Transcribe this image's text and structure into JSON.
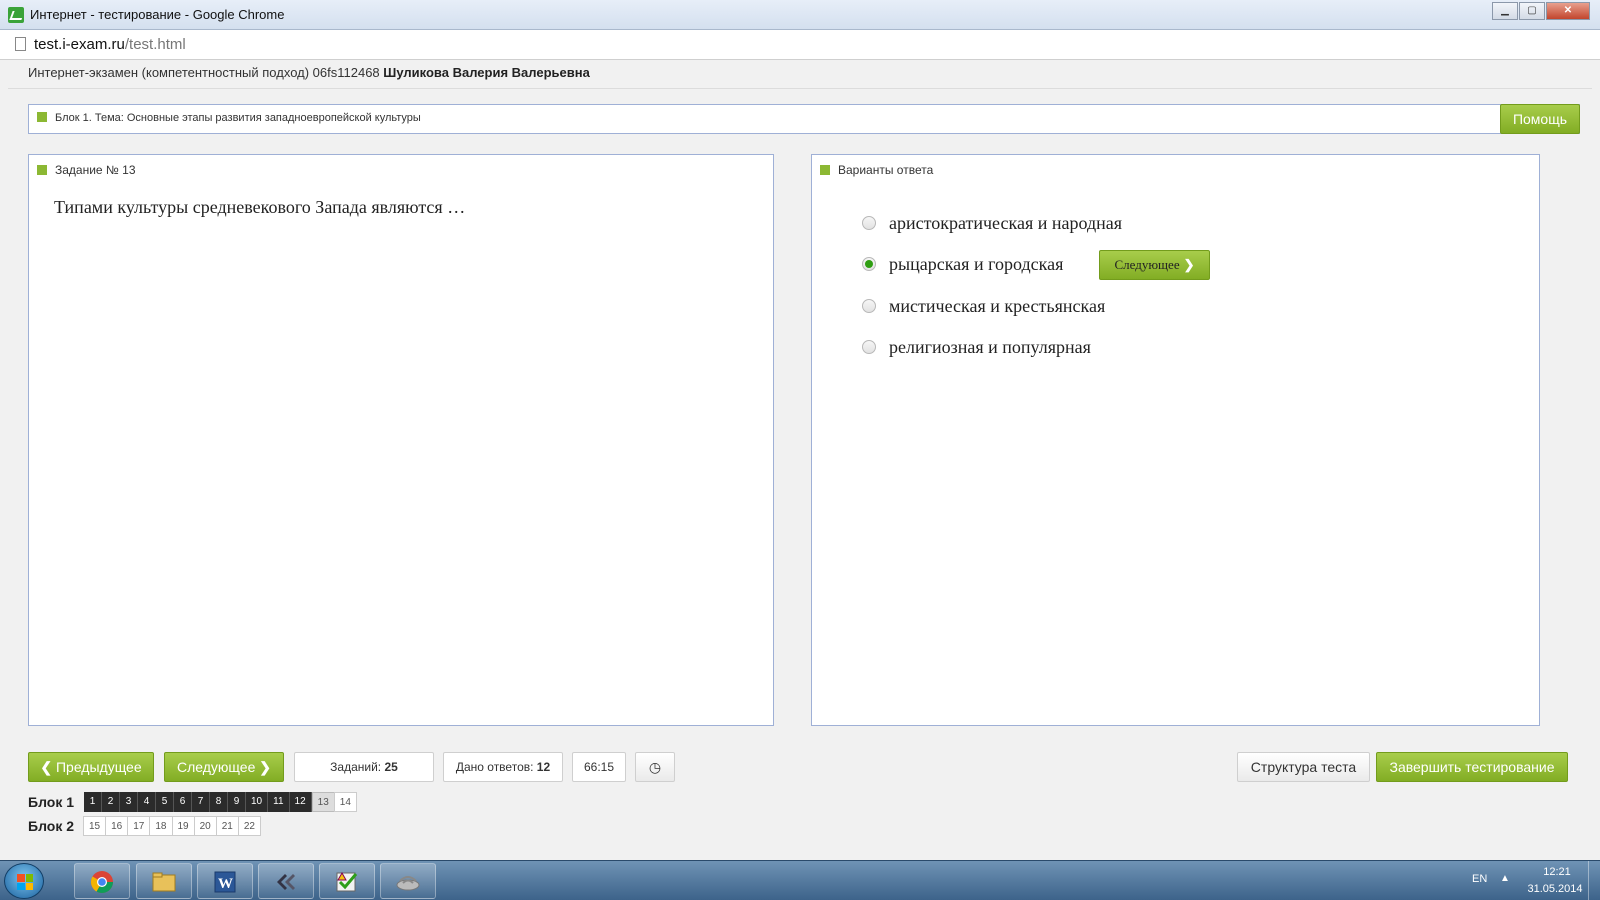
{
  "window": {
    "title": "Интернет - тестирование - Google Chrome",
    "buttons": {
      "minimize": "▁",
      "maximize": "▢",
      "close": "✕"
    }
  },
  "address": {
    "host": "test.i-exam.ru",
    "path": "/test.html"
  },
  "exam": {
    "header": "Интернет-экзамен (компетентностный подход) 06fs112468",
    "student": "Шуликова Валерия Валерьевна"
  },
  "block_bar": {
    "label": "Блок 1. Тема: Основные этапы развития западноевропейской культуры",
    "help": "Помощь"
  },
  "task": {
    "label": "Задание № 13",
    "question": "Типами культуры средневекового Запада являются …"
  },
  "answers": {
    "label": "Варианты ответа",
    "options": [
      {
        "text": "аристократическая и народная",
        "selected": false
      },
      {
        "text": "рыцарская и городская",
        "selected": true
      },
      {
        "text": "мистическая и крестьянская",
        "selected": false
      },
      {
        "text": "религиозная и популярная",
        "selected": false
      }
    ],
    "next_label": "Следующее"
  },
  "controls": {
    "prev": "Предыдущее",
    "next": "Следующее",
    "tasks_label": "Заданий:",
    "tasks_count": "25",
    "answered_label": "Дано ответов:",
    "answered_count": "12",
    "timer": "66:15",
    "structure": "Структура теста",
    "finish": "Завершить тестирование"
  },
  "blocks": [
    {
      "name": "Блок 1",
      "items": [
        "1",
        "2",
        "3",
        "4",
        "5",
        "6",
        "7",
        "8",
        "9",
        "10",
        "11",
        "12",
        "13",
        "14"
      ]
    },
    {
      "name": "Блок 2",
      "items": [
        "15",
        "16",
        "17",
        "18",
        "19",
        "20",
        "21",
        "22"
      ]
    }
  ],
  "taskbar": {
    "lang": "EN",
    "time": "12:21",
    "date": "31.05.2014",
    "apps": [
      "chrome-icon",
      "folder-icon",
      "word-icon",
      "app-icon",
      "checklist-icon",
      "network-icon"
    ]
  },
  "colors": {
    "accent": "#8cb833",
    "accent_dark": "#739c1c",
    "panel_border": "#9fb0d6",
    "answered": "#2b2b2b"
  }
}
